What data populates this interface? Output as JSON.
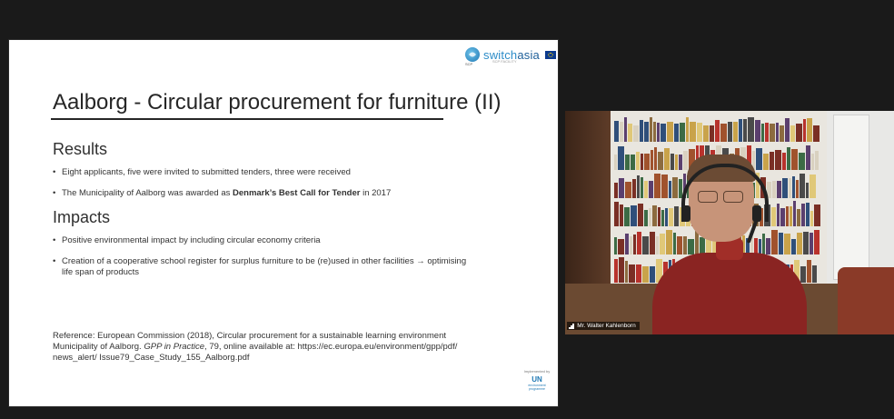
{
  "slide": {
    "logo": {
      "brand_prefix": "switch",
      "brand_suffix": "asia",
      "sub_label": "SCP",
      "tagline": "SCP FACILITY"
    },
    "title": "Aalborg - Circular procurement for furniture (II)",
    "results": {
      "heading": "Results",
      "bullets": [
        {
          "text": "Eight applicants, five were invited to submitted tenders, three were received"
        },
        {
          "pre": "The Municipality of Aalborg was awarded as ",
          "bold": "Denmark’s Best Call for Tender",
          "post": " in 2017"
        }
      ]
    },
    "impacts": {
      "heading": "Impacts",
      "bullets": [
        {
          "text": "Positive environmental impact by including circular economy criteria"
        },
        {
          "line1": "Creation of a cooperative school register for surplus furniture to be (re)used in other facilities → optimising",
          "line2": "life span of products"
        }
      ]
    },
    "reference": {
      "line1": "Reference: European Commission (2018), Circular procurement for a sustainable learning environment",
      "line2_pre": "Municipality of Aalborg. ",
      "line2_italic": "GPP in Practice",
      "line2_post": ", 79, online available at: https://ec.europa.eu/environment/gpp/pdf/",
      "line3": "news_alert/ Issue79_Case_Study_155_Aalborg.pdf"
    },
    "implemented_by": {
      "label": "Implemented by",
      "org": "UN",
      "org_sub": "environment programme"
    }
  },
  "video": {
    "participant_name": "Mr. Walter Kahlenborn"
  },
  "colors": {
    "background": "#1a1a1a",
    "brand_blue": "#2c8cc8",
    "sweater_red": "#8a2422"
  }
}
